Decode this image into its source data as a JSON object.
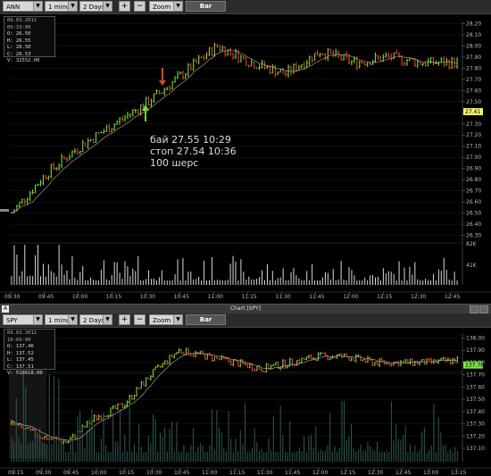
{
  "top": {
    "toolbar": {
      "symbol": "ANN",
      "interval": "1 minute",
      "range": "2 Days",
      "plus": "+",
      "minus": "−",
      "zoom": "Zoom",
      "style": "Bar"
    },
    "ohlc": {
      "timestamp": "09.03.2012 09:33:00",
      "open": "O: 26.50",
      "high": "H: 26.55",
      "low": "L: 26.50",
      "close": "C: 26.53",
      "volume": "V: 32552.00"
    },
    "price_ticks": [
      "28.20",
      "28.10",
      "28.00",
      "27.90",
      "27.80",
      "27.70",
      "27.60",
      "27.50",
      "27.40",
      "27.30",
      "27.20",
      "27.10",
      "27.00",
      "26.90",
      "26.80",
      "26.70",
      "26.60",
      "26.50",
      "26.40",
      "26.30"
    ],
    "last_price": "27.41",
    "volume_ticks": [
      "82K",
      "41K"
    ],
    "time_ticks": [
      "09:30",
      "09:45",
      "10:00",
      "10:15",
      "10:30",
      "10:45",
      "11:00",
      "11:15",
      "11:30",
      "11:45",
      "12:00",
      "12:15",
      "12:30",
      "12:45"
    ],
    "note_lines": [
      "бай  27.55  10:29",
      "стоп  27.54  10:36",
      "100  шерс"
    ]
  },
  "window_title": "Chart [SPY]",
  "window_logo": "A",
  "bottom": {
    "toolbar": {
      "symbol": "SPY",
      "interval": "1 minute",
      "range": "2 Days",
      "plus": "+",
      "minus": "−",
      "zoom": "Zoom",
      "style": "Bar"
    },
    "ohlc": {
      "timestamp": "09.03.2012 10:09:00",
      "open": "O: 137.46",
      "high": "H: 137.52",
      "low": "L: 137.45",
      "close": "C: 137.51",
      "volume": "V: 518618.00"
    },
    "price_ticks": [
      "138.00",
      "137.90",
      "137.80",
      "137.70",
      "137.60",
      "137.50",
      "137.40",
      "137.30",
      "137.20",
      "137.10"
    ],
    "last_price": "137.78",
    "time_ticks": [
      "09:15",
      "09:30",
      "09:45",
      "10:00",
      "10:15",
      "10:30",
      "10:45",
      "11:00",
      "11:15",
      "11:30",
      "11:45",
      "12:00",
      "12:15",
      "12:30",
      "12:45",
      "13:00",
      "13:15"
    ]
  },
  "colors": {
    "up": "#7cd63a",
    "down": "#e0452d",
    "volume": "#d8d8d8",
    "last_price_top": "#f0f06a",
    "last_price_bottom": "#7ee04a",
    "ma_line": "#b0b0b0"
  },
  "chart_data": [
    {
      "type": "bar",
      "symbol": "ANN",
      "ylim": [
        26.3,
        28.2
      ],
      "x": [
        "09:30",
        "09:45",
        "10:00",
        "10:15",
        "10:30",
        "10:45",
        "11:00",
        "11:15",
        "11:30",
        "11:45",
        "12:00",
        "12:15",
        "12:30",
        "12:45"
      ],
      "close": [
        26.55,
        26.85,
        27.1,
        27.3,
        27.5,
        27.75,
        28.0,
        27.85,
        27.75,
        27.95,
        27.85,
        27.9,
        27.85,
        27.85
      ]
    },
    {
      "type": "bar",
      "symbol": "SPY",
      "ylim": [
        137.05,
        138.05
      ],
      "x": [
        "09:15",
        "09:30",
        "09:45",
        "10:00",
        "10:15",
        "10:30",
        "10:45",
        "11:00",
        "11:15",
        "11:30",
        "11:45",
        "12:00",
        "12:15",
        "12:30",
        "12:45",
        "13:00",
        "13:15"
      ],
      "close": [
        137.3,
        137.2,
        137.15,
        137.35,
        137.45,
        137.7,
        137.9,
        137.85,
        137.8,
        137.75,
        137.8,
        137.85,
        137.85,
        137.8,
        137.8,
        137.8,
        137.82
      ]
    }
  ]
}
